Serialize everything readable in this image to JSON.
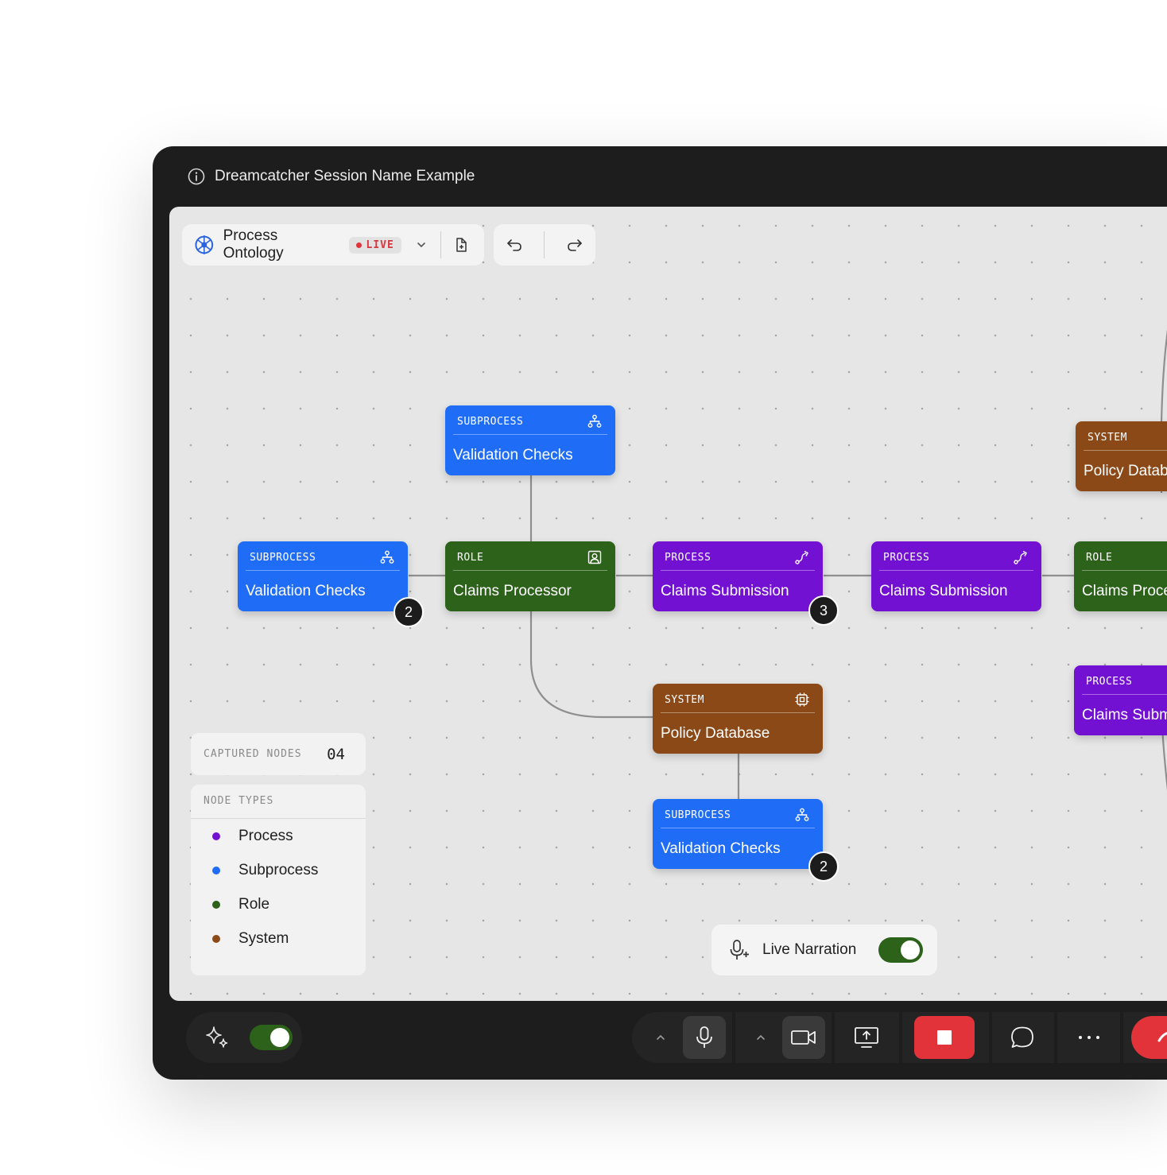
{
  "window": {
    "title": "Dreamcatcher Session Name Example"
  },
  "toolbar": {
    "project_name": "Process Ontology",
    "live_label": "LIVE"
  },
  "nodes": [
    {
      "type": "SUBPROCESS",
      "label": "Validation Checks"
    },
    {
      "type": "SUBPROCESS",
      "label": "Validation Checks",
      "badge": "2"
    },
    {
      "type": "ROLE",
      "label": "Claims Processor"
    },
    {
      "type": "PROCESS",
      "label": "Claims Submission",
      "badge": "3"
    },
    {
      "type": "PROCESS",
      "label": "Claims Submission"
    },
    {
      "type": "SYSTEM",
      "label": "Policy Database"
    },
    {
      "type": "SUBPROCESS",
      "label": "Validation Checks",
      "badge": "2"
    },
    {
      "type": "SYSTEM",
      "label": "Policy Datab"
    },
    {
      "type": "ROLE",
      "label": "Claims Proce"
    },
    {
      "type": "PROCESS",
      "label": "Claims Subm"
    }
  ],
  "stats": {
    "captured_label": "CAPTURED NODES",
    "captured_value": "04"
  },
  "legend": {
    "title": "NODE TYPES",
    "items": [
      {
        "label": "Process",
        "color": "#7311d2"
      },
      {
        "label": "Subprocess",
        "color": "#1f6cf6"
      },
      {
        "label": "Role",
        "color": "#2c621a"
      },
      {
        "label": "System",
        "color": "#8a4916"
      }
    ]
  },
  "narration": {
    "label": "Live Narration",
    "enabled": true
  },
  "controls": {
    "ai_assist_enabled": true
  },
  "colors": {
    "subprocess": "#1f6cf6",
    "role": "#2c621a",
    "process": "#7311d2",
    "system": "#8a4916",
    "live": "#e0343b",
    "toggle_on": "#2c621a",
    "end_call": "#e3333a"
  }
}
